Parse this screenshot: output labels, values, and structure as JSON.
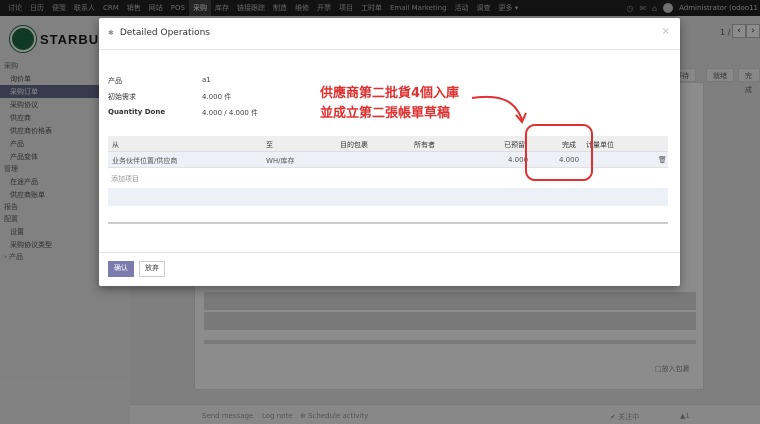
{
  "topbar": {
    "menu": [
      "讨论",
      "日历",
      "便笺",
      "联系人",
      "CRM",
      "销售",
      "网站",
      "POS",
      "采购",
      "库存",
      "链接跟踪",
      "制造",
      "维修",
      "开票",
      "项目",
      "工时单",
      "Email Marketing",
      "活动",
      "调查",
      "更多 ▾"
    ],
    "active_index": 8,
    "user": "Administrator (odoo11"
  },
  "sidebar": {
    "logo_text": "STARBUC",
    "items": [
      {
        "label": "采购",
        "type": "header"
      },
      {
        "label": "询价单",
        "type": "item"
      },
      {
        "label": "采购订单",
        "type": "item",
        "active": true
      },
      {
        "label": "采购协议",
        "type": "item"
      },
      {
        "label": "供应商",
        "type": "item"
      },
      {
        "label": "供应商价格表",
        "type": "item"
      },
      {
        "label": "产品",
        "type": "item"
      },
      {
        "label": "产品变体",
        "type": "item"
      },
      {
        "label": "管理",
        "type": "header"
      },
      {
        "label": "在途产品",
        "type": "item"
      },
      {
        "label": "供应商账单",
        "type": "item"
      },
      {
        "label": "报告",
        "type": "header"
      },
      {
        "label": "配置",
        "type": "header"
      },
      {
        "label": "设置",
        "type": "item"
      },
      {
        "label": "采购协议类型",
        "type": "item"
      },
      {
        "label": "› 产品",
        "type": "header"
      }
    ]
  },
  "background": {
    "pager": "1 / 2",
    "status_waiting": "等待",
    "status_ready": "就绪",
    "status_done": "完成",
    "add_package": "□放入包裹",
    "footer_send": "Send message",
    "footer_log": "Log note",
    "footer_schedule": "⊕ Schedule activity",
    "footer_follow": "✔ 关注中",
    "footer_followers": "▲1"
  },
  "modal": {
    "title": "Detailed Operations",
    "close": "×",
    "fields": [
      {
        "label": "产品",
        "value": "a1",
        "bold": false
      },
      {
        "label": "初始需求",
        "value": "4.000 件",
        "bold": false
      },
      {
        "label": "Quantity Done",
        "value": "4.000 / 4.000 件",
        "bold": true
      }
    ],
    "table": {
      "headers": [
        "从",
        "至",
        "目的包裹",
        "所有者",
        "已预留",
        "完成",
        "计量单位"
      ],
      "row": {
        "from": "业务伙伴位置/供应商",
        "to": "WH/库存",
        "package": "",
        "owner": "",
        "reserved": "4.000",
        "done": "4.000",
        "uom": ""
      },
      "add_line": "添加项目"
    },
    "confirm": "确认",
    "discard": "放弃"
  },
  "annotation": {
    "line1": "供應商第二批貨4個入庫",
    "line2": "並成立第二張帳單草稿",
    "color": "#e03030"
  }
}
